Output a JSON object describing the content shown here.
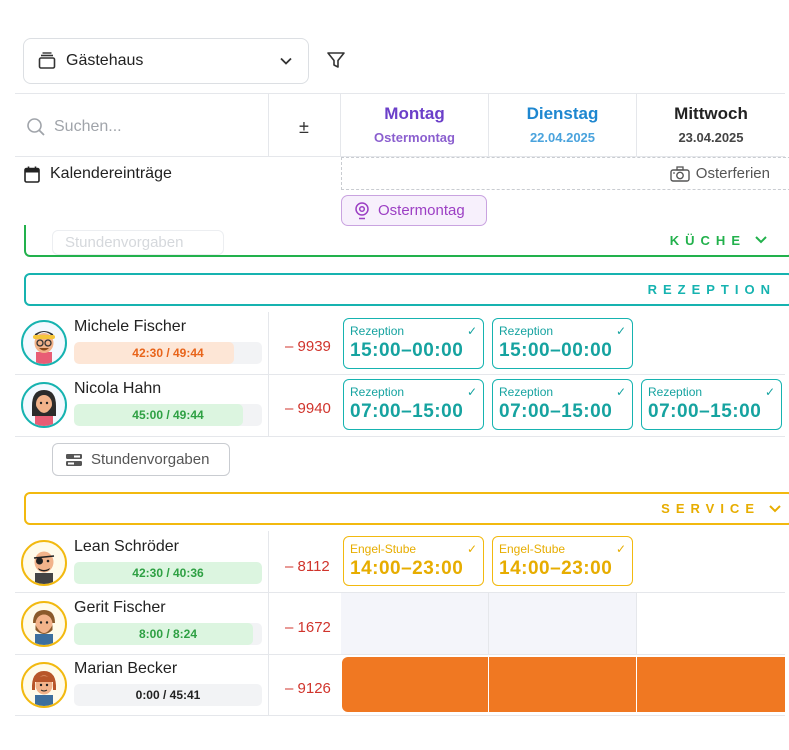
{
  "toolbar": {
    "house_label": "Gästehaus",
    "icons": [
      "stack-icon",
      "chevron-down-icon",
      "filter-icon"
    ]
  },
  "header": {
    "search_placeholder": "Suchen...",
    "plus_minus": "±",
    "days": [
      {
        "name": "Montag",
        "sub": "Ostermontag",
        "color": "#6b3fc9",
        "sub_color": "#8b5fcf"
      },
      {
        "name": "Dienstag",
        "sub": "22.04.2025",
        "color": "#1e87d0",
        "sub_color": "#4aa3dd"
      },
      {
        "name": "Mittwoch",
        "sub": "23.04.2025",
        "color": "#222222",
        "sub_color": "#444444"
      }
    ]
  },
  "calendar": {
    "label": "Kalendereinträge",
    "ferien": "Osterferien",
    "holiday_chip": "Ostermontag"
  },
  "groups": {
    "kueche": {
      "label": "KÜCHE",
      "color": "#22b14c"
    },
    "rezeption": {
      "label": "REZEPTION",
      "color": "#16b3b0"
    },
    "service": {
      "label": "SERVICE",
      "color": "#f2b90f"
    }
  },
  "ghost_button": "Stundenvorgaben",
  "stundenvorgaben_button": "Stundenvorgaben",
  "rezeption_staff": [
    {
      "name": "Michele Fischer",
      "hours": "42:30 / 49:44",
      "delta": "– 9939",
      "hours_level": 0.85,
      "hours_color": "#e8641a",
      "hours_bg": "#fde6d6",
      "shifts": [
        {
          "title": "Rezeption",
          "time": "15:00–00:00"
        },
        {
          "title": "Rezeption",
          "time": "15:00–00:00"
        }
      ]
    },
    {
      "name": "Nicola Hahn",
      "hours": "45:00 / 49:44",
      "delta": "– 9940",
      "hours_level": 0.9,
      "hours_color": "#2ea043",
      "hours_bg": "#dcf5e0",
      "shifts": [
        {
          "title": "Rezeption",
          "time": "07:00–15:00"
        },
        {
          "title": "Rezeption",
          "time": "07:00–15:00"
        },
        {
          "title": "Rezeption",
          "time": "07:00–15:00"
        }
      ]
    }
  ],
  "service_staff": [
    {
      "name": "Lean Schröder",
      "hours": "42:30 / 40:36",
      "delta": "– 8112",
      "hours_level": 1.0,
      "hours_color": "#2ea043",
      "hours_bg": "#dcf5e0",
      "shifts": [
        {
          "title": "Engel-Stube",
          "time": "14:00–23:00"
        },
        {
          "title": "Engel-Stube",
          "time": "14:00–23:00"
        }
      ]
    },
    {
      "name": "Gerit Fischer",
      "hours": "8:00 / 8:24",
      "delta": "– 1672",
      "hours_level": 0.95,
      "hours_color": "#2ea043",
      "hours_bg": "#dcf5e0",
      "shifts": []
    },
    {
      "name": "Marian Becker",
      "hours": "0:00 / 45:41",
      "delta": "– 9126",
      "hours_level": 0.0,
      "hours_color": "#222222",
      "hours_bg": "#f2f3f5",
      "shifts": []
    }
  ]
}
